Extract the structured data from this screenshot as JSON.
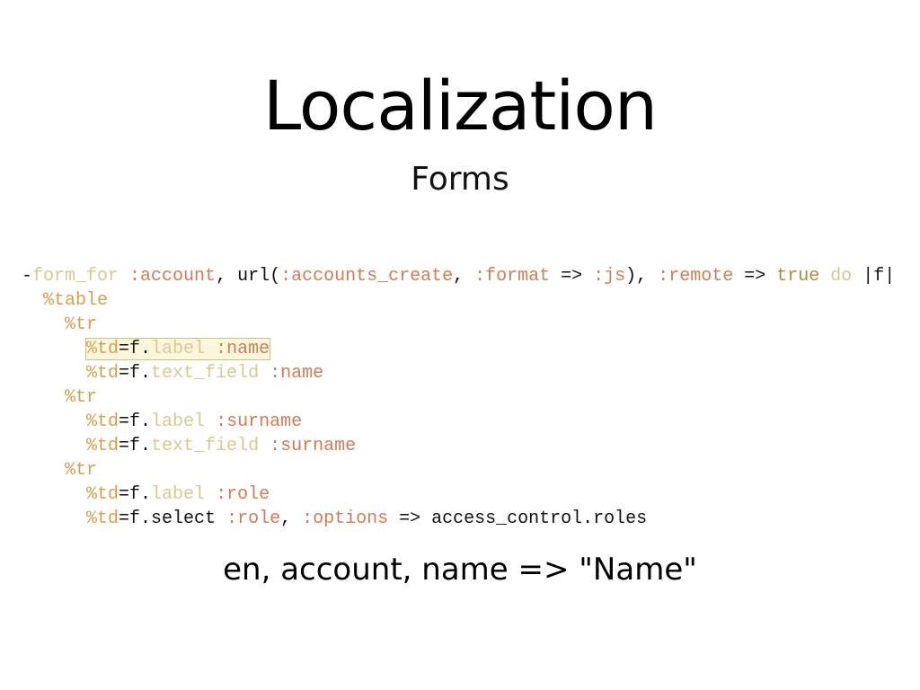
{
  "slide": {
    "title": "Localization",
    "subtitle": "Forms",
    "footnote": "en, account, name => \"Name\""
  },
  "code": {
    "lines": [
      [
        {
          "t": "-",
          "c": "tok-plain"
        },
        {
          "t": "form_for",
          "c": "tok-dim"
        },
        {
          "t": " ",
          "c": "tok-plain"
        },
        {
          "t": ":account",
          "c": "tok-key"
        },
        {
          "t": ", url(",
          "c": "tok-plain"
        },
        {
          "t": ":accounts_create",
          "c": "tok-key"
        },
        {
          "t": ", ",
          "c": "tok-plain"
        },
        {
          "t": ":format",
          "c": "tok-key"
        },
        {
          "t": " => ",
          "c": "tok-plain"
        },
        {
          "t": ":js",
          "c": "tok-key"
        },
        {
          "t": "), ",
          "c": "tok-plain"
        },
        {
          "t": ":remote",
          "c": "tok-key"
        },
        {
          "t": " => ",
          "c": "tok-plain"
        },
        {
          "t": "true",
          "c": "tok-kw"
        },
        {
          "t": " ",
          "c": "tok-plain"
        },
        {
          "t": "do",
          "c": "tok-dim"
        },
        {
          "t": " |f|",
          "c": "tok-plain"
        }
      ],
      [
        {
          "t": "  ",
          "c": "tok-plain"
        },
        {
          "t": "%table",
          "c": "tok-sym"
        }
      ],
      [
        {
          "t": "    ",
          "c": "tok-plain"
        },
        {
          "t": "%tr",
          "c": "tok-sym"
        }
      ],
      [
        {
          "t": "      ",
          "c": "tok-plain"
        },
        {
          "t": "%td",
          "c": "tok-sym",
          "hl": true
        },
        {
          "t": "=f.",
          "c": "tok-plain",
          "hl": true
        },
        {
          "t": "label",
          "c": "tok-dim",
          "hl": true
        },
        {
          "t": " ",
          "c": "tok-plain",
          "hl": true
        },
        {
          "t": ":name",
          "c": "tok-key",
          "hl": true
        }
      ],
      [
        {
          "t": "      ",
          "c": "tok-plain"
        },
        {
          "t": "%td",
          "c": "tok-sym"
        },
        {
          "t": "=f.",
          "c": "tok-plain"
        },
        {
          "t": "text_field",
          "c": "tok-dim"
        },
        {
          "t": " ",
          "c": "tok-plain"
        },
        {
          "t": ":name",
          "c": "tok-key"
        }
      ],
      [
        {
          "t": "    ",
          "c": "tok-plain"
        },
        {
          "t": "%tr",
          "c": "tok-sym"
        }
      ],
      [
        {
          "t": "      ",
          "c": "tok-plain"
        },
        {
          "t": "%td",
          "c": "tok-sym"
        },
        {
          "t": "=f.",
          "c": "tok-plain"
        },
        {
          "t": "label",
          "c": "tok-dim"
        },
        {
          "t": " ",
          "c": "tok-plain"
        },
        {
          "t": ":surname",
          "c": "tok-key"
        }
      ],
      [
        {
          "t": "      ",
          "c": "tok-plain"
        },
        {
          "t": "%td",
          "c": "tok-sym"
        },
        {
          "t": "=f.",
          "c": "tok-plain"
        },
        {
          "t": "text_field",
          "c": "tok-dim"
        },
        {
          "t": " ",
          "c": "tok-plain"
        },
        {
          "t": ":surname",
          "c": "tok-key"
        }
      ],
      [
        {
          "t": "    ",
          "c": "tok-plain"
        },
        {
          "t": "%tr",
          "c": "tok-sym"
        }
      ],
      [
        {
          "t": "      ",
          "c": "tok-plain"
        },
        {
          "t": "%td",
          "c": "tok-sym"
        },
        {
          "t": "=f.",
          "c": "tok-plain"
        },
        {
          "t": "label",
          "c": "tok-dim"
        },
        {
          "t": " ",
          "c": "tok-plain"
        },
        {
          "t": ":role",
          "c": "tok-key"
        }
      ],
      [
        {
          "t": "      ",
          "c": "tok-plain"
        },
        {
          "t": "%td",
          "c": "tok-sym"
        },
        {
          "t": "=f.select ",
          "c": "tok-plain"
        },
        {
          "t": ":role",
          "c": "tok-key"
        },
        {
          "t": ", ",
          "c": "tok-plain"
        },
        {
          "t": ":options",
          "c": "tok-key"
        },
        {
          "t": " => access_control.roles",
          "c": "tok-plain"
        }
      ]
    ]
  },
  "colors": {
    "symbol": "#cf7d57",
    "haml_tag": "#d4a04b",
    "method_dim": "#d9c98f",
    "keyword": "#b48a3c",
    "highlight_border": "#c9c083",
    "highlight_fill": "#fbf7dd"
  }
}
